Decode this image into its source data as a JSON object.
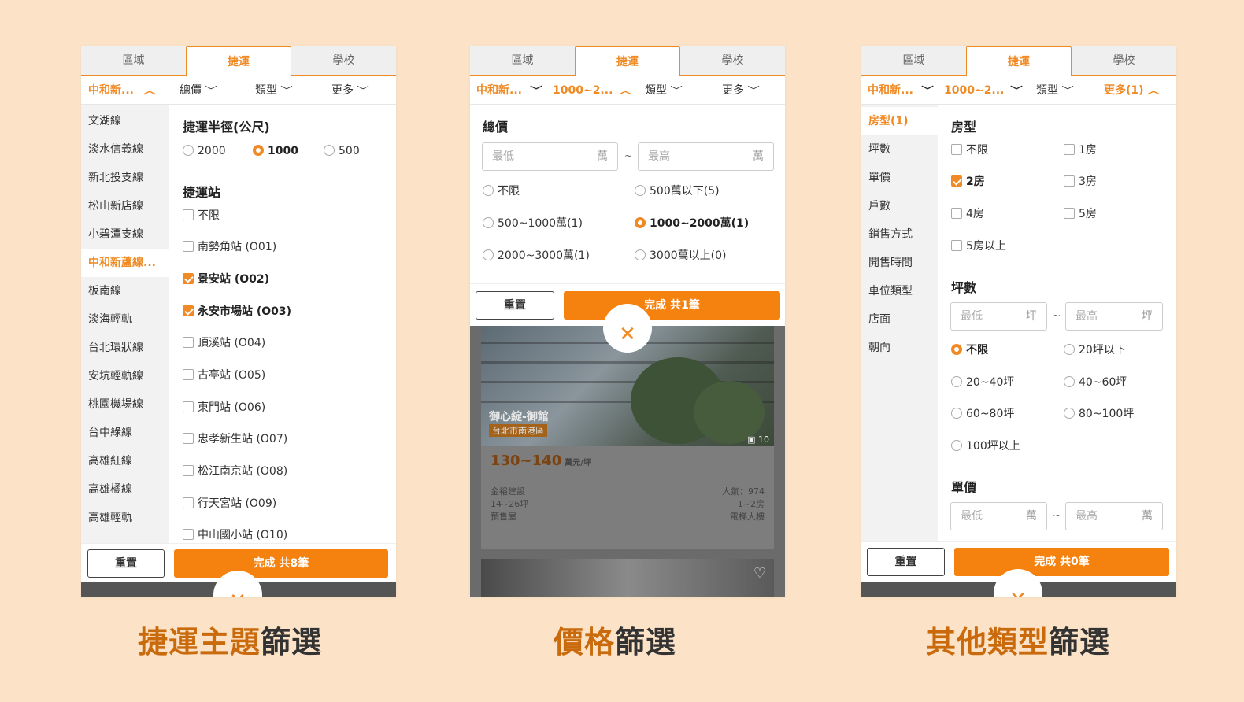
{
  "accent_color": "#f08a24",
  "tabs": [
    "區域",
    "捷運",
    "學校"
  ],
  "panel1": {
    "filters": {
      "area": "中和新...",
      "total": "總價",
      "type": "類型",
      "more": "更多"
    },
    "sidebar": [
      "文湖線",
      "淡水信義線",
      "新北投支線",
      "松山新店線",
      "小碧潭支線",
      "中和新蘆線...",
      "板南線",
      "淡海輕軌",
      "台北環狀線",
      "安坑輕軌線",
      "桃園機場線",
      "台中綠線",
      "高雄紅線",
      "高雄橘線",
      "高雄輕軌"
    ],
    "sidebar_selected": 5,
    "radius_title": "捷運半徑(公尺)",
    "radius_options": [
      "2000",
      "1000",
      "500"
    ],
    "radius_selected": 1,
    "stations_title": "捷運站",
    "stations": [
      "不限",
      "南勢角站 (O01)",
      "景安站 (O02)",
      "永安市場站 (O03)",
      "頂溪站 (O04)",
      "古亭站 (O05)",
      "東門站 (O06)",
      "忠孝新生站 (O07)",
      "松江南京站 (O08)",
      "行天宮站 (O09)",
      "中山國小站 (O10)"
    ],
    "stations_checked": [
      2,
      3
    ],
    "reset": "重置",
    "done": "完成 共8筆",
    "close": "✕"
  },
  "panel2": {
    "filters": {
      "area": "中和新...",
      "total": "1000~2...",
      "type": "類型",
      "more": "更多"
    },
    "price_title": "總價",
    "min_placeholder": "最低",
    "max_placeholder": "最高",
    "unit": "萬",
    "tilde": "~",
    "price_options": [
      "不限",
      "500萬以下(5)",
      "500~1000萬(1)",
      "1000~2000萬(1)",
      "2000~3000萬(1)",
      "3000萬以上(0)"
    ],
    "price_selected": 3,
    "reset": "重置",
    "done": "完成 共1筆",
    "close": "✕",
    "listing": {
      "name": "御心綻-御館",
      "location": "台北市南港區",
      "photo_count": "10",
      "price": "130~140",
      "price_unit": "萬元/坪",
      "builder": "金裕建設",
      "size": "14~26坪",
      "status": "預售屋",
      "popularity": "人氣：974",
      "rooms": "1~2房",
      "building_type": "電梯大樓"
    }
  },
  "panel3": {
    "filters": {
      "area": "中和新...",
      "total": "1000~2...",
      "type": "類型",
      "more": "更多(1)"
    },
    "sidebar": [
      "房型(1)",
      "坪數",
      "單價",
      "戶數",
      "銷售方式",
      "開售時間",
      "車位類型",
      "店面",
      "朝向"
    ],
    "sidebar_selected": 0,
    "room_title": "房型",
    "room_options": [
      "不限",
      "1房",
      "2房",
      "3房",
      "4房",
      "5房",
      "5房以上"
    ],
    "room_checked": [
      2
    ],
    "ping_title": "坪數",
    "ping_unit": "坪",
    "ping_options": [
      "不限",
      "20坪以下",
      "20~40坪",
      "40~60坪",
      "60~80坪",
      "80~100坪",
      "100坪以上"
    ],
    "ping_selected": 0,
    "unit_price_title": "單價",
    "unit_price_unit": "萬",
    "min_placeholder": "最低",
    "max_placeholder": "最高",
    "tilde": "~",
    "reset": "重置",
    "done": "完成 共0筆",
    "close": "✕"
  },
  "captions": [
    {
      "highlight": "捷運主題",
      "rest": "篩選"
    },
    {
      "highlight": "價格",
      "rest": "篩選"
    },
    {
      "highlight": "其他類型",
      "rest": "篩選"
    }
  ]
}
